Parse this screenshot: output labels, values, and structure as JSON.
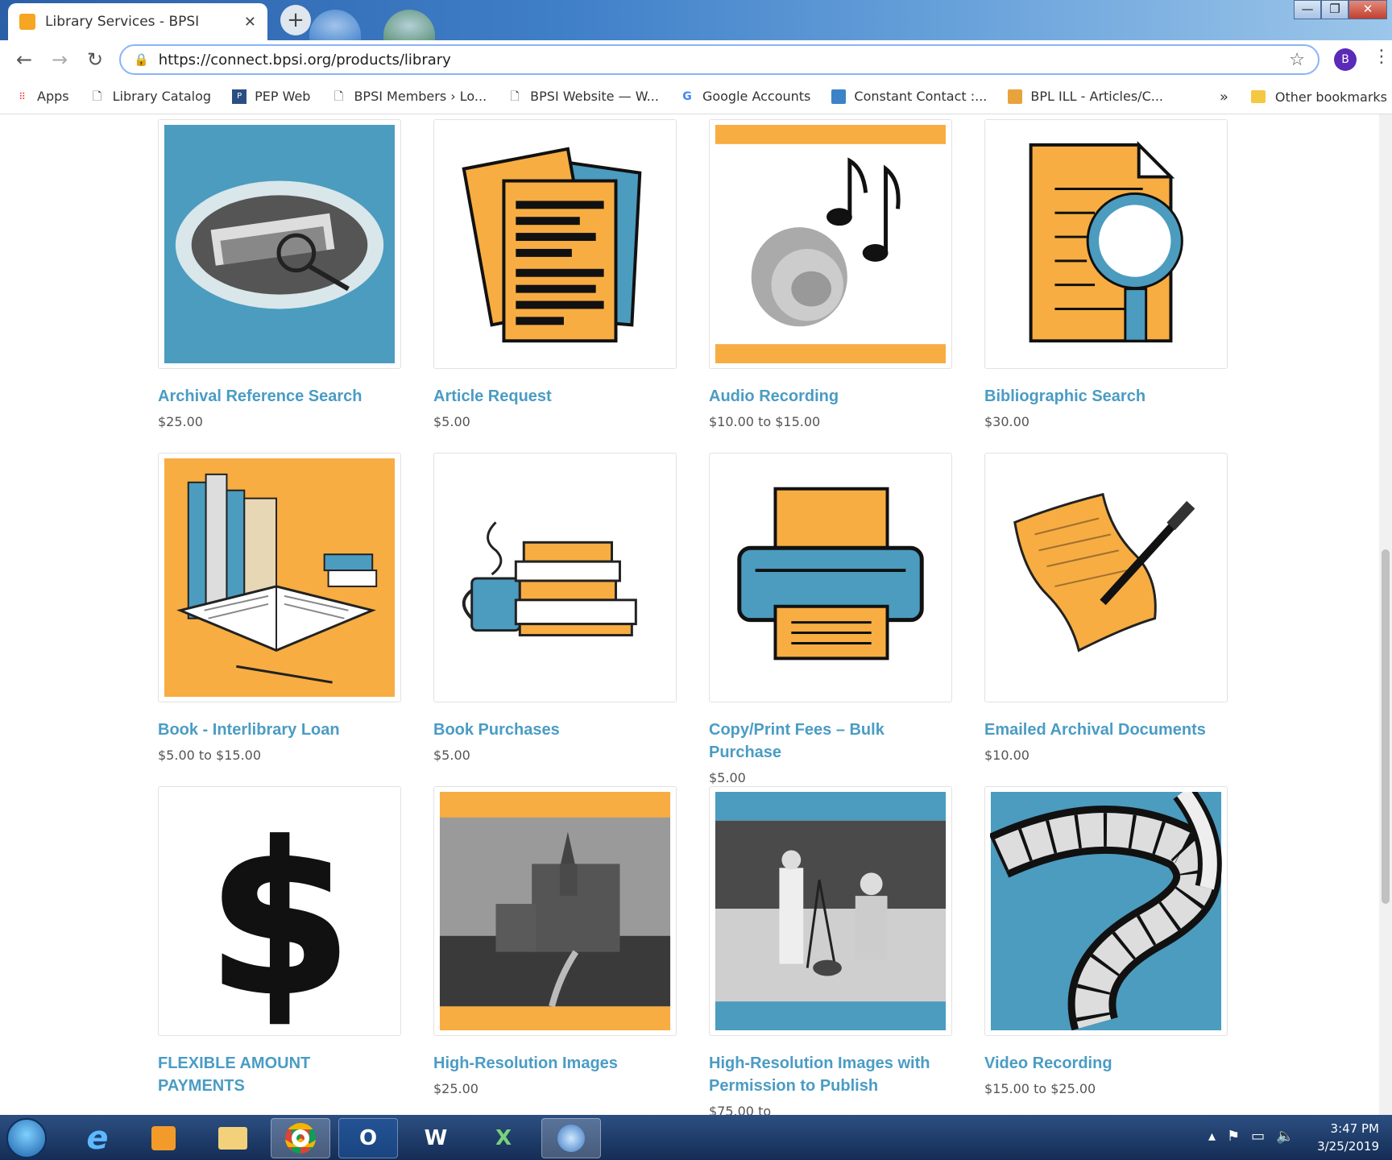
{
  "browser": {
    "tab_title": "Library Services - BPSI",
    "tab_close": "✕",
    "new_tab": "+",
    "url": "https://connect.bpsi.org/products/library",
    "avatar_letter": "B",
    "window_buttons": [
      "—",
      "❐",
      "✕"
    ]
  },
  "bookmarks": {
    "items": [
      {
        "label": "Apps",
        "icon": "apps-grid-icon"
      },
      {
        "label": "Library Catalog",
        "icon": "page-icon"
      },
      {
        "label": "PEP Web",
        "icon": "pep-web-icon"
      },
      {
        "label": "BPSI Members › Lo...",
        "icon": "page-icon"
      },
      {
        "label": "BPSI Website — W...",
        "icon": "page-icon"
      },
      {
        "label": "Google Accounts",
        "icon": "google-icon"
      },
      {
        "label": "Constant Contact :...",
        "icon": "constant-contact-icon"
      },
      {
        "label": "BPL ILL - Articles/C...",
        "icon": "bpl-icon"
      }
    ],
    "overflow": "»",
    "other": "Other bookmarks"
  },
  "products": [
    {
      "name": "Archival Reference Search",
      "price": "$25.00"
    },
    {
      "name": "Article Request",
      "price": "$5.00"
    },
    {
      "name": "Audio Recording",
      "price": "$10.00 to $15.00"
    },
    {
      "name": "Bibliographic Search",
      "price": "$30.00"
    },
    {
      "name": "Book - Interlibrary Loan",
      "price": "$5.00 to $15.00"
    },
    {
      "name": "Book Purchases",
      "price": "$5.00"
    },
    {
      "name": "Copy/Print Fees – Bulk Purchase",
      "price": "$5.00"
    },
    {
      "name": "Emailed Archival Documents",
      "price": "$10.00"
    },
    {
      "name": "FLEXIBLE AMOUNT PAYMENTS",
      "price": ""
    },
    {
      "name": "High-Resolution Images",
      "price": "$25.00"
    },
    {
      "name": "High-Resolution Images with Permission to Publish",
      "price": "$75.00 to"
    },
    {
      "name": "Video Recording",
      "price": "$15.00 to $25.00"
    }
  ],
  "colors": {
    "accent": "#4a9cc4",
    "orange": "#f7ad42",
    "blue": "#4b9cbf"
  },
  "taskbar": {
    "apps": [
      "IE",
      "Media",
      "Explorer",
      "Chrome",
      "Outlook",
      "Word",
      "Excel",
      "Network"
    ],
    "outlook_label": "O",
    "word_label": "W",
    "excel_label": "X",
    "time": "3:47 PM",
    "date": "3/25/2019"
  }
}
